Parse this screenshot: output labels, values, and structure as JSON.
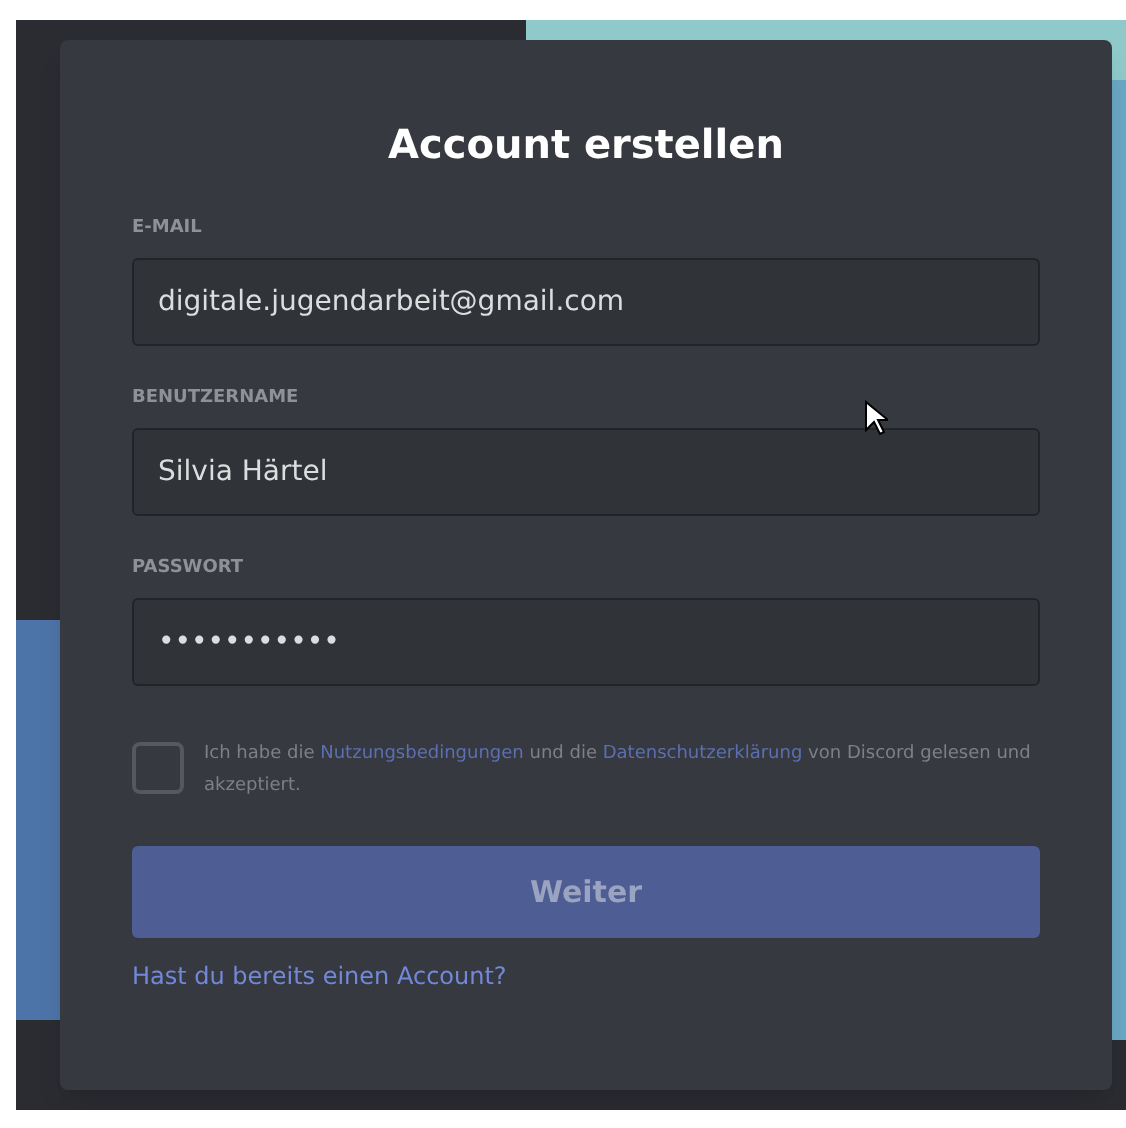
{
  "title": "Account erstellen",
  "fields": [
    {
      "label": "E-MAIL",
      "value": "digitale.jugendarbeit@gmail.com"
    },
    {
      "label": "BENUTZERNAME",
      "value": "Silvia Härtel"
    },
    {
      "label": "PASSWORT",
      "value": "•••••••••••"
    }
  ],
  "agreement": {
    "checked": false,
    "parts": [
      {
        "kind": "text",
        "text": "Ich habe die"
      },
      {
        "kind": "link",
        "text": "Nutzungsbedingungen"
      },
      {
        "kind": "text",
        "text": "und die"
      },
      {
        "kind": "link",
        "text": "Datenschutzerklärung"
      },
      {
        "kind": "text",
        "text": "von Discord gelesen und akzeptiert."
      }
    ]
  },
  "submit": {
    "label": "Weiter",
    "disabled": true
  },
  "login_link": "Hast du bereits einen Account?"
}
